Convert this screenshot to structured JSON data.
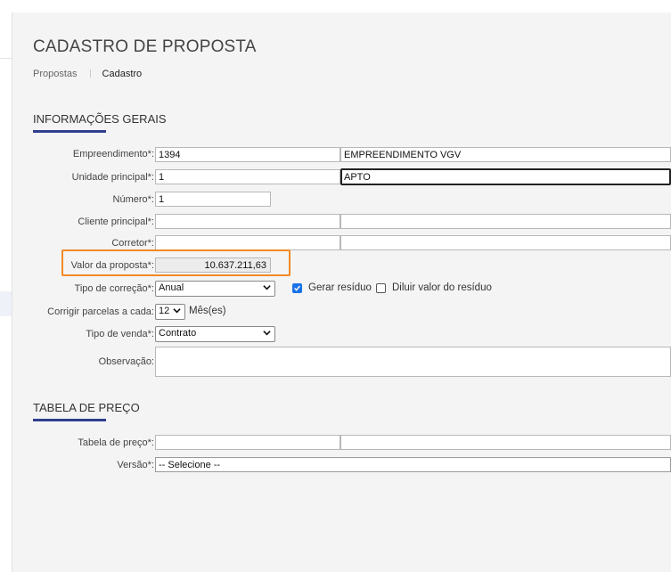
{
  "page": {
    "title": "CADASTRO DE PROPOSTA",
    "breadcrumb": [
      "Propostas",
      "Cadastro"
    ]
  },
  "sections": {
    "geral": "INFORMAÇÕES GERAIS",
    "preco": "TABELA DE PREÇO"
  },
  "form": {
    "empreendimento": {
      "label": "Empreendimento*:",
      "code": "1394",
      "name": "EMPREENDIMENTO VGV"
    },
    "unidade": {
      "label": "Unidade principal*:",
      "code": "1",
      "name": "APTO"
    },
    "numero": {
      "label": "Número*:",
      "value": "1"
    },
    "cliente": {
      "label": "Cliente principal*:",
      "code": "",
      "name": ""
    },
    "corretor": {
      "label": "Corretor*:",
      "code": "",
      "name": ""
    },
    "valor": {
      "label": "Valor da proposta*:",
      "value": "10.637.211,63"
    },
    "tipo_correcao": {
      "label": "Tipo de correção*:",
      "selected": "Anual"
    },
    "gerar_residuo": {
      "label": "Gerar resíduo",
      "checked": true
    },
    "diluir_residuo": {
      "label": "Diluir valor do resíduo",
      "checked": false
    },
    "corrigir": {
      "label": "Corrigir parcelas a cada:",
      "selected": "12",
      "unit": "Mês(es)"
    },
    "tipo_venda": {
      "label": "Tipo de venda*:",
      "selected": "Contrato"
    },
    "observacao": {
      "label": "Observação:",
      "value": ""
    }
  },
  "preco": {
    "tabela": {
      "label": "Tabela de preço*:",
      "code": "",
      "name": ""
    },
    "versao": {
      "label": "Versão*:",
      "selected": "-- Selecione --"
    }
  },
  "colors": {
    "accent": "#2f3f8f",
    "highlight": "#f08a24",
    "checkbox": "#1a73e8"
  },
  "icons": [
    "chevron-down-icon",
    "checkbox-checked-icon"
  ]
}
